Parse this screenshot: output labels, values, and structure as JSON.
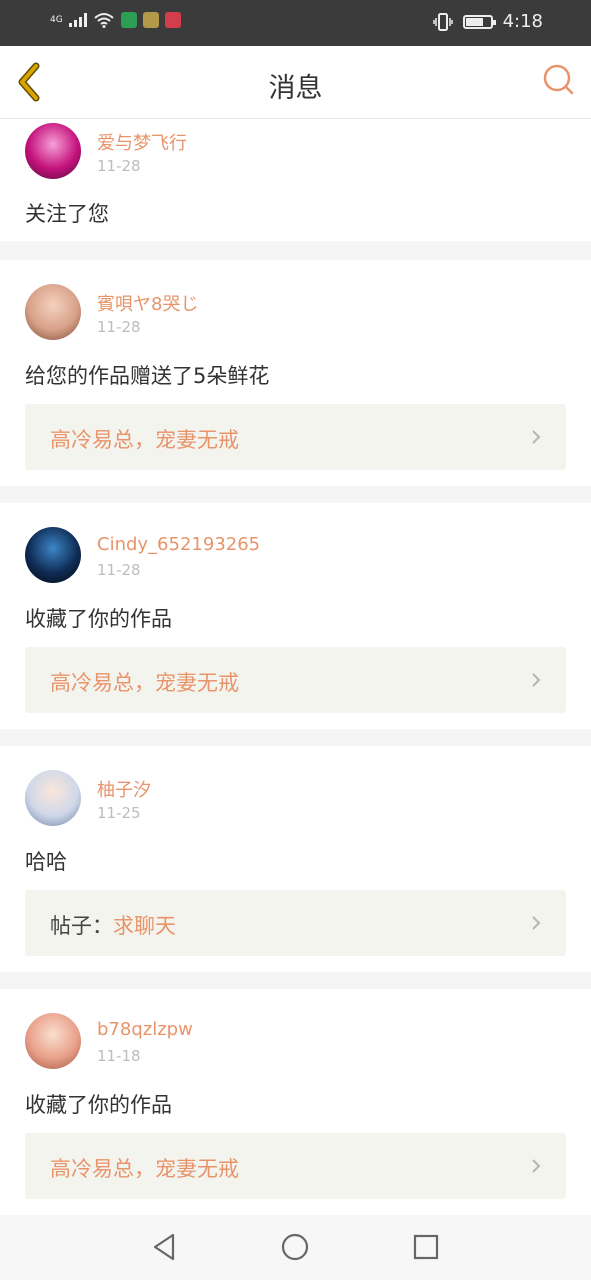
{
  "status_bar": {
    "network": "4G",
    "time": "4:18",
    "battery_level": 0.7,
    "app_icon_colors": [
      "#2e9e55",
      "#b39a4a",
      "#d23e4b"
    ]
  },
  "header": {
    "title": "消息",
    "back_icon": "chevron-left-icon",
    "search_icon": "search-icon",
    "accent_color": "#e8946a",
    "back_color": "#d9a400"
  },
  "messages": [
    {
      "user": "爱与梦飞行",
      "date": "11-28",
      "action": "关注了您",
      "avatar_colors": [
        "#f6a0d7",
        "#c4127c",
        "#4a0c36"
      ]
    },
    {
      "user": "賓唄ヤ8哭じ",
      "date": "11-28",
      "action": "给您的作品赠送了5朵鲜花",
      "link": {
        "text": "高冷易总，宠妻无戒"
      },
      "avatar_colors": [
        "#f4d2bf",
        "#d8a088",
        "#7a4a34"
      ]
    },
    {
      "user": "Cindy_652193265",
      "date": "11-28",
      "action": "收藏了你的作品",
      "link": {
        "text": "高冷易总，宠妻无戒"
      },
      "avatar_colors": [
        "#3d86c8",
        "#0f2c55",
        "#020810"
      ]
    },
    {
      "user": "柚子汐",
      "date": "11-25",
      "action": "哈哈",
      "link": {
        "prefix": "帖子：",
        "text": "求聊天"
      },
      "avatar_colors": [
        "#fbe6dc",
        "#cfd8e8",
        "#6b7fa4"
      ]
    },
    {
      "user": "b78qzlzpw",
      "date": "11-18",
      "action": "收藏了你的作品",
      "link": {
        "text": "高冷易总，宠妻无戒"
      },
      "avatar_colors": [
        "#f9dfcf",
        "#e9a08a",
        "#a0553f"
      ]
    }
  ],
  "nav_bar": {
    "back": "triangle-back-icon",
    "home": "circle-home-icon",
    "recents": "square-recents-icon"
  }
}
